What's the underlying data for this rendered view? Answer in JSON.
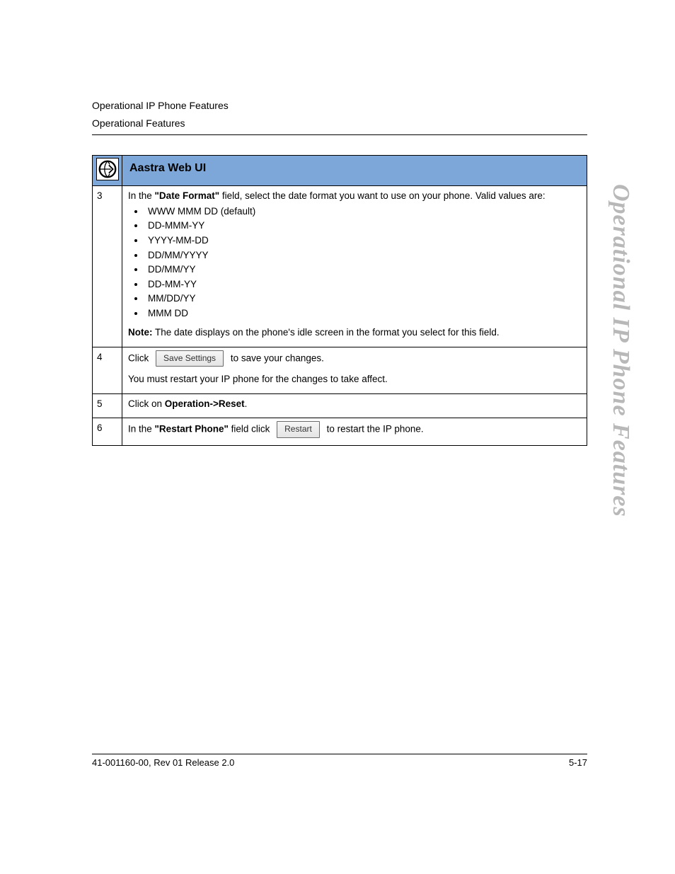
{
  "header": {
    "line1": "Operational IP Phone Features",
    "line2": "Operational Features"
  },
  "side_title": "Operational IP Phone Features",
  "table": {
    "title": "Aastra Web UI",
    "rows": [
      {
        "num": "3",
        "intro_pre": "In the ",
        "intro_bold": "\"Date Format\"",
        "intro_post": " field, select the date format you want to use on your phone. Valid values are:",
        "bullets": [
          "WWW MMM DD (default)",
          "DD-MMM-YY",
          "YYYY-MM-DD",
          "DD/MM/YYYY",
          "DD/MM/YY",
          "DD-MM-YY",
          "MM/DD/YY",
          "MMM DD"
        ],
        "note_label": "Note:",
        "note_text": " The date displays on the phone's idle screen in the format you select for this field."
      },
      {
        "num": "4",
        "click_label": "Click",
        "button_label": "Save Settings",
        "after_button": "to save your changes.",
        "restart_note": "You must restart your IP phone for the changes to take affect."
      },
      {
        "num": "5",
        "clickon_pre": "Click on ",
        "clickon_bold": "Operation->Reset",
        "clickon_post": "."
      },
      {
        "num": "6",
        "restart_pre": "In the ",
        "restart_bold": "\"Restart Phone\"",
        "restart_mid": " field click",
        "button_label": "Restart",
        "restart_post": "to restart the IP phone."
      }
    ]
  },
  "footer": {
    "left": "41-001160-00, Rev 01  Release 2.0",
    "right": "5-17"
  }
}
